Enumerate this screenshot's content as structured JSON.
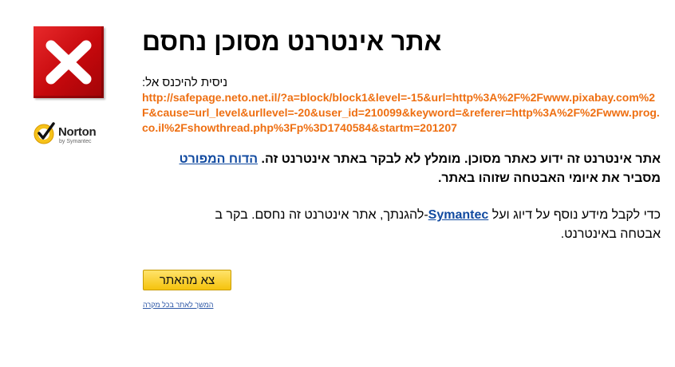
{
  "page": {
    "title": "אתר אינטרנט מסוכן נחסם",
    "attempt_label": "ניסית להיכנס אל:",
    "blocked_url": "http://safepage.neto.net.il/?a=block/block1&level=-15&url=http%3A%2F%2Fwww.pixabay.com%2F&cause=url_level&urllevel=-20&user_id=210099&keyword=&referer=http%3A%2F%2Fwww.prog.co.il%2Fshowthread.php%3Fp%3D1740584&startm=201207",
    "warning_text": "אתר אינטרנט זה ידוע כאתר מסוכן. מומלץ לא לבקר באתר אינטרנט זה.",
    "report_link": "הדוח המפורט",
    "warning_text_2": "מסביר את איומי האבטחה שזוהו באתר.",
    "info_text": "כדי לקבל מידע נוסף על דיוג ועל",
    "symantec_link": "Symantec",
    "info_text_2": "-להגנתך, אתר אינטרנט זה נחסם. בקר ב",
    "info_text_3": "אבטחה באינטרנט.",
    "exit_button": "צא מהאתר",
    "continue_link": "המשך לאתר בכל מקרה"
  },
  "brand": {
    "name": "Norton",
    "sub": "by Symantec"
  },
  "colors": {
    "block_red": "#d0141a",
    "url_orange": "#ee6f12",
    "link_blue": "#114aa0",
    "button_yellow": "#f5c30d"
  },
  "icons": {
    "block": "x-block-icon",
    "norton": "norton-check-icon"
  }
}
